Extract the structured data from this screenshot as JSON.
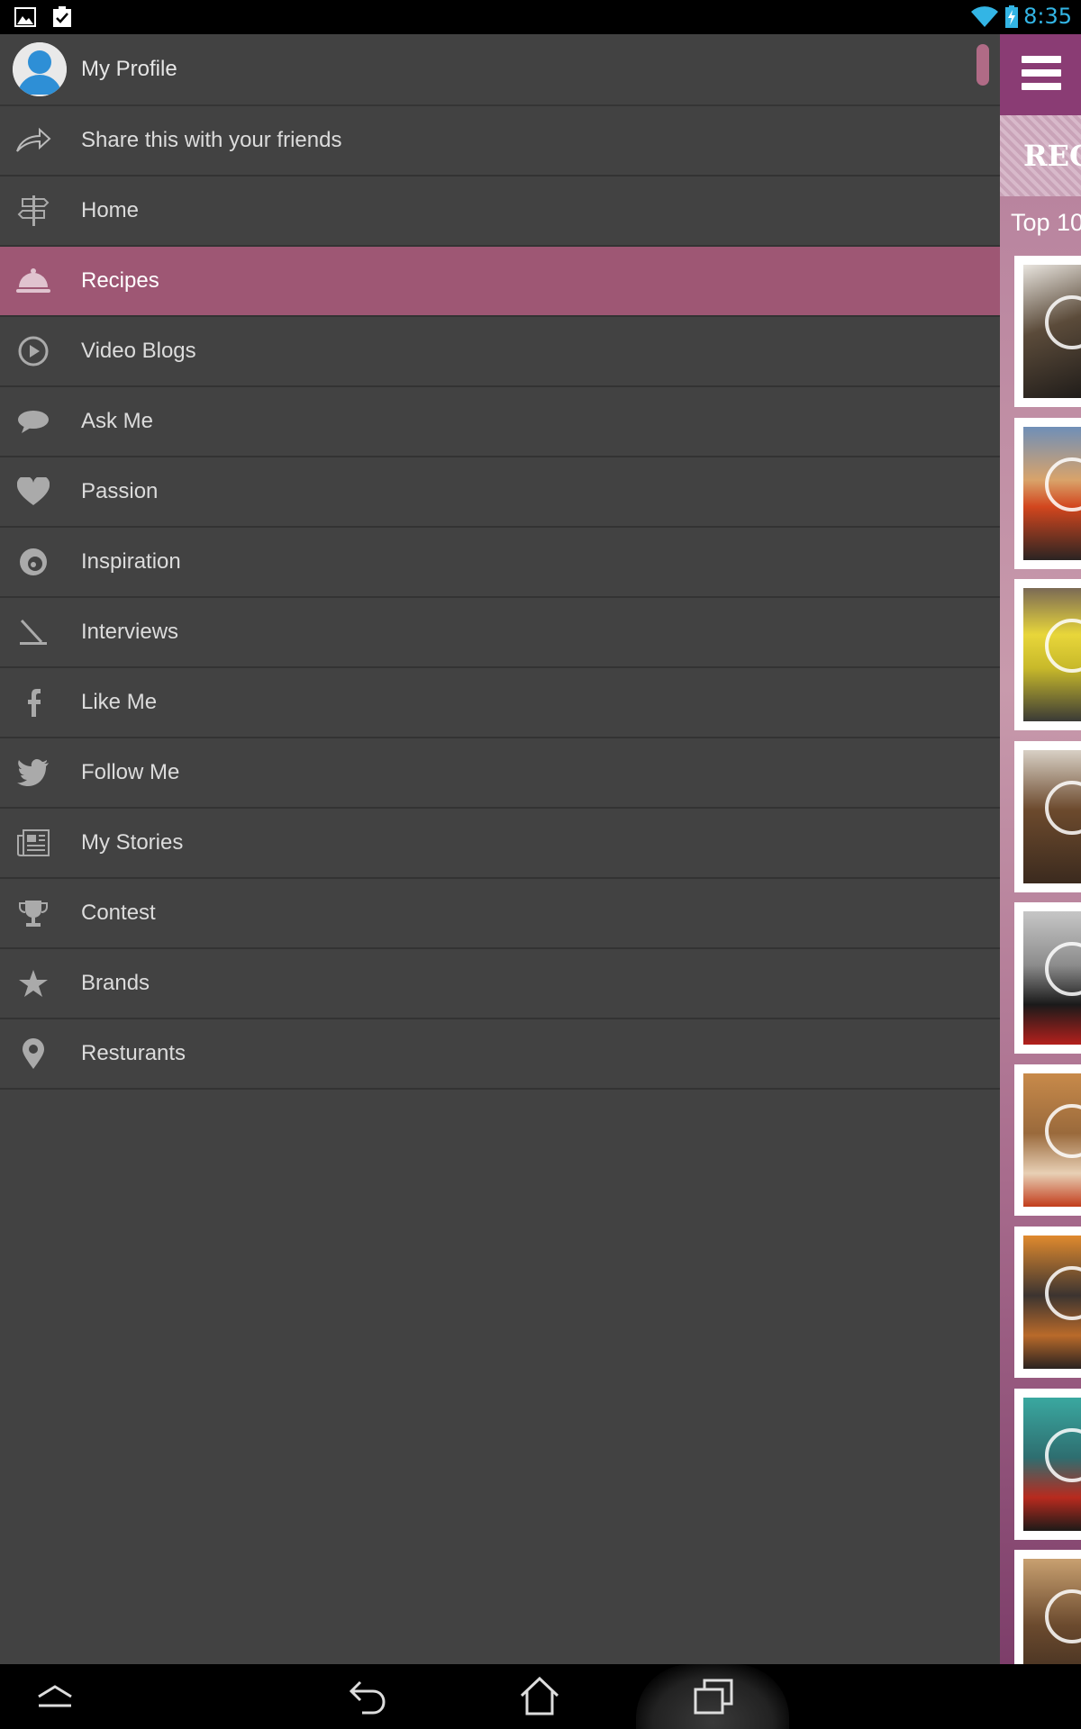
{
  "status_bar": {
    "time": "8:35",
    "left_icons": [
      "image-notification-icon",
      "task-done-notification-icon"
    ],
    "right_icons": [
      "wifi-icon",
      "battery-charging-icon"
    ],
    "accent_color": "#33b5e5"
  },
  "drawer": {
    "profile": {
      "label": "My Profile",
      "icon": "avatar-icon"
    },
    "items": [
      {
        "label": "Share this with your friends",
        "icon": "share-icon",
        "active": false
      },
      {
        "label": "Home",
        "icon": "signpost-icon",
        "active": false
      },
      {
        "label": "Recipes",
        "icon": "cloche-icon",
        "active": true
      },
      {
        "label": "Video Blogs",
        "icon": "play-icon",
        "active": false
      },
      {
        "label": "Ask Me",
        "icon": "speech-bubble-icon",
        "active": false
      },
      {
        "label": "Passion",
        "icon": "heart-icon",
        "active": false
      },
      {
        "label": "Inspiration",
        "icon": "spiral-icon",
        "active": false
      },
      {
        "label": "Interviews",
        "icon": "interviews-icon",
        "active": false
      },
      {
        "label": "Like Me",
        "icon": "facebook-icon",
        "active": false
      },
      {
        "label": "Follow Me",
        "icon": "twitter-icon",
        "active": false
      },
      {
        "label": "My Stories",
        "icon": "newspaper-icon",
        "active": false
      },
      {
        "label": "Contest",
        "icon": "trophy-icon",
        "active": false
      },
      {
        "label": "Brands",
        "icon": "star-icon",
        "active": false
      },
      {
        "label": "Resturants",
        "icon": "map-pin-icon",
        "active": false
      }
    ],
    "active_color": "#9e5774"
  },
  "content": {
    "banner_text": "REC",
    "section_title": "Top 10",
    "menu_icon": "hamburger-icon",
    "thumbnail_count": 9
  },
  "nav_bar": {
    "buttons": [
      "collapse-icon",
      "back-icon",
      "home-icon",
      "recent-apps-icon"
    ]
  }
}
